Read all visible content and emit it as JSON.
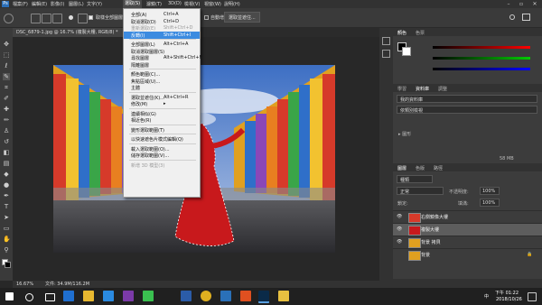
{
  "menubar": {
    "items": [
      "檔案(F)",
      "編輯(E)",
      "影像(I)",
      "圖層(L)",
      "文字(Y)",
      "選取(S)",
      "濾鏡(T)",
      "3D(D)",
      "檢視(V)",
      "視窗(W)",
      "說明(H)"
    ],
    "active_index": 5
  },
  "options": {
    "sample_all": "取樣全部圖層",
    "auto_enhance": "自動增強",
    "select_mask": "選取並遮住..."
  },
  "document": {
    "tab": "DSC_6879-1.jpg @ 16.7% (複製大樓, RGB/8) *",
    "zoom": "16.67%",
    "file_info": "文件: 34.9M/116.2M"
  },
  "select_menu": {
    "items": [
      {
        "label": "全部(A)",
        "shortcut": "Ctrl+A",
        "disabled": false,
        "highlight": false
      },
      {
        "label": "取消選取(D)",
        "shortcut": "Ctrl+D",
        "disabled": false,
        "highlight": false
      },
      {
        "label": "重新選取(E)",
        "shortcut": "Shift+Ctrl+D",
        "disabled": true,
        "highlight": false
      },
      {
        "label": "反轉(I)",
        "shortcut": "Shift+Ctrl+I",
        "disabled": false,
        "highlight": true
      },
      {
        "sep": true
      },
      {
        "label": "全部圖層(L)",
        "shortcut": "Alt+Ctrl+A",
        "disabled": false,
        "highlight": false
      },
      {
        "label": "取消選取圖層(S)",
        "shortcut": "",
        "disabled": false,
        "highlight": false
      },
      {
        "label": "尋找圖層",
        "shortcut": "Alt+Shift+Ctrl+F",
        "disabled": false,
        "highlight": false
      },
      {
        "label": "隔離圖層",
        "shortcut": "",
        "disabled": false,
        "highlight": false
      },
      {
        "sep": true
      },
      {
        "label": "顏色範圍(C)...",
        "shortcut": "",
        "disabled": false,
        "highlight": false
      },
      {
        "label": "焦點區域(U)...",
        "shortcut": "",
        "disabled": false,
        "highlight": false
      },
      {
        "label": "主體",
        "shortcut": "",
        "disabled": false,
        "highlight": false
      },
      {
        "sep": true
      },
      {
        "label": "選取並遮住(K)...",
        "shortcut": "Alt+Ctrl+R",
        "disabled": false,
        "highlight": false
      },
      {
        "label": "修改(M)",
        "shortcut": "▸",
        "disabled": false,
        "highlight": false
      },
      {
        "sep": true
      },
      {
        "label": "連續相似(G)",
        "shortcut": "",
        "disabled": false,
        "highlight": false
      },
      {
        "label": "相近色(R)",
        "shortcut": "",
        "disabled": false,
        "highlight": false
      },
      {
        "sep": true
      },
      {
        "label": "變形選取範圍(T)",
        "shortcut": "",
        "disabled": false,
        "highlight": false
      },
      {
        "sep": true
      },
      {
        "label": "以快速遮色片模式編輯(Q)",
        "shortcut": "",
        "disabled": false,
        "highlight": false
      },
      {
        "sep": true
      },
      {
        "label": "載入選取範圍(O)...",
        "shortcut": "",
        "disabled": false,
        "highlight": false
      },
      {
        "label": "儲存選取範圍(V)...",
        "shortcut": "",
        "disabled": false,
        "highlight": false
      },
      {
        "sep": true
      },
      {
        "label": "新增 3D 模型(3)",
        "shortcut": "",
        "disabled": true,
        "highlight": false
      }
    ]
  },
  "panels": {
    "color_tabs": [
      "顏色",
      "色票"
    ],
    "mid_tabs": [
      "學習",
      "資料庫",
      "調整"
    ],
    "library_dropdown": "我的資料庫",
    "search_placeholder": "依類別檢視",
    "library_group": "▸ 圖形",
    "size": "58 MB",
    "layers_tabs": [
      "圖層",
      "色版",
      "路徑"
    ],
    "kind": "種類",
    "blend_mode": "正常",
    "opacity_label": "不透明度:",
    "opacity": "100%",
    "lock_label": "鎖定:",
    "fill_label": "填滿:",
    "fill": "100%",
    "layers": [
      {
        "name": "右側鏡像大樓",
        "selected": false
      },
      {
        "name": "複製大樓",
        "selected": true
      },
      {
        "name": "背景 拷貝",
        "selected": false
      },
      {
        "name": "背景",
        "selected": false
      }
    ]
  },
  "taskbar": {
    "time": "下午 01:22",
    "date": "2018/10/26",
    "ime": "中"
  },
  "colors": {
    "menu_highlight": "#3c8be0",
    "dress_red": "#c8191c"
  }
}
